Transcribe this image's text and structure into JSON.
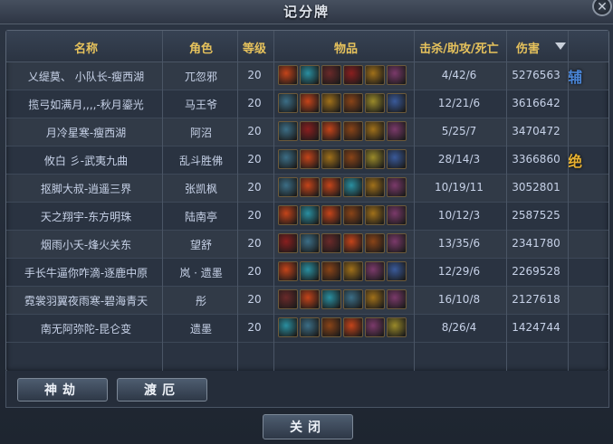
{
  "title": "记分牌",
  "columns": {
    "name": "名称",
    "role": "角色",
    "level": "等级",
    "items": "物品",
    "kda": "击杀/助攻/死亡",
    "damage": "伤害"
  },
  "rows": [
    {
      "name": "乂缇莫、 小队长-瘦西湖",
      "role": "兀忽邪",
      "level": "20",
      "kda": "4/42/6",
      "damage": "5276563",
      "badge": "辅",
      "badge_color": "#4a86d8",
      "items": [
        "fire",
        "orb",
        "sword",
        "blade",
        "amulet",
        "cross"
      ]
    },
    {
      "name": "揽弓如满月,,,,-秋月鎏光",
      "role": "马王爷",
      "level": "20",
      "kda": "12/21/6",
      "damage": "3616642",
      "badge": "",
      "badge_color": "",
      "items": [
        "skull",
        "fire",
        "amulet",
        "gourd",
        "gold",
        "spear"
      ]
    },
    {
      "name": "月冷星寒-瘦西湖",
      "role": "阿沼",
      "level": "20",
      "kda": "5/25/7",
      "damage": "3470472",
      "badge": "",
      "badge_color": "",
      "items": [
        "skull",
        "blade",
        "fire",
        "gourd",
        "amulet",
        "cross"
      ]
    },
    {
      "name": "攸白 彡-武夷九曲",
      "role": "乱斗胜佛",
      "level": "20",
      "kda": "28/14/3",
      "damage": "3366860",
      "badge": "绝",
      "badge_color": "#e6b030",
      "items": [
        "skull",
        "fire",
        "amulet",
        "gourd",
        "gold",
        "spear"
      ]
    },
    {
      "name": "抠脚大叔-逍遥三界",
      "role": "张凯枫",
      "level": "20",
      "kda": "10/19/11",
      "damage": "3052801",
      "badge": "",
      "badge_color": "",
      "items": [
        "skull",
        "fire",
        "fire",
        "orb",
        "amulet",
        "cross"
      ]
    },
    {
      "name": "天之翔宇-东方明珠",
      "role": "陆南亭",
      "level": "20",
      "kda": "10/12/3",
      "damage": "2587525",
      "badge": "",
      "badge_color": "",
      "items": [
        "fire",
        "orb",
        "fire",
        "gourd",
        "amulet",
        "cross"
      ]
    },
    {
      "name": "烟雨小夭-烽火关东",
      "role": "望舒",
      "level": "20",
      "kda": "13/35/6",
      "damage": "2341780",
      "badge": "",
      "badge_color": "",
      "items": [
        "blade",
        "skull",
        "sword",
        "fire",
        "gourd",
        "cross"
      ]
    },
    {
      "name": "手长牛逼你咋滴-逐鹿中原",
      "role": "岚 · 遗墨",
      "level": "20",
      "kda": "12/29/6",
      "damage": "2269528",
      "badge": "",
      "badge_color": "",
      "items": [
        "fire",
        "orb",
        "gourd",
        "amulet",
        "cross",
        "spear"
      ]
    },
    {
      "name": "霓裳羽翼夜雨寒-碧海青天",
      "role": "彤",
      "level": "20",
      "kda": "16/10/8",
      "damage": "2127618",
      "badge": "",
      "badge_color": "",
      "items": [
        "sword",
        "fire",
        "orb",
        "skull",
        "amulet",
        "cross"
      ]
    },
    {
      "name": "南无阿弥陀-昆仑变",
      "role": "遗墨",
      "level": "20",
      "kda": "8/26/4",
      "damage": "1424744",
      "badge": "",
      "badge_color": "",
      "items": [
        "orb",
        "skull",
        "gourd",
        "fire",
        "cross",
        "gold"
      ]
    }
  ],
  "buttons": {
    "shenjie": "神劫",
    "duer": "渡厄",
    "close": "关闭",
    "close_icon": "close-icon",
    "sort_icon": "sort-down-icon"
  },
  "item_colors": {
    "fire": "#c4441a",
    "orb": "#2a8fa0",
    "sword": "#6a2a2a",
    "blade": "#8a1f1f",
    "amulet": "#a0701a",
    "cross": "#7b3a6a",
    "skull": "#3c6e86",
    "gourd": "#8a4418",
    "gold": "#9a8a2a",
    "spear": "#3a5a9a"
  }
}
